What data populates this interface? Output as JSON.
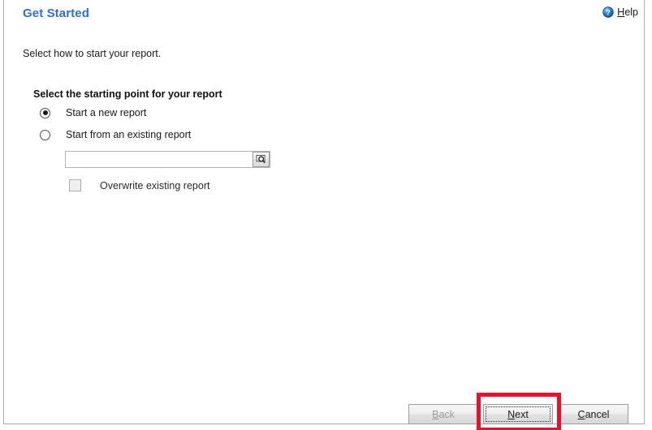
{
  "window": {
    "title": "Get Started"
  },
  "header": {
    "title": "Get Started",
    "help": {
      "label_accel": "H",
      "label_rest": "elp",
      "full_label": "Help",
      "icon": "help-circle-icon"
    }
  },
  "main": {
    "instruction": "Select how to start your report.",
    "group_heading": "Select the starting point for your report",
    "options": [
      {
        "label": "Start a new report",
        "selected": true
      },
      {
        "label": "Start from an existing report",
        "selected": false
      }
    ],
    "existing_report_field": {
      "value": "",
      "placeholder": "",
      "browse_icon": "browse-search-icon"
    },
    "overwrite_checkbox": {
      "label": "Overwrite existing report",
      "checked": false
    }
  },
  "footer": {
    "buttons": [
      {
        "name": "back",
        "accel": "B",
        "rest": "ack",
        "full_label": "Back",
        "disabled": true,
        "focused": false
      },
      {
        "name": "next",
        "accel": "N",
        "rest": "ext",
        "full_label": "Next",
        "disabled": false,
        "focused": true
      },
      {
        "name": "cancel",
        "accel": "C",
        "rest": "ancel",
        "full_label": "Cancel",
        "disabled": false,
        "focused": false
      }
    ]
  },
  "annotation": {
    "target": "Next",
    "color": "#e8112d"
  }
}
